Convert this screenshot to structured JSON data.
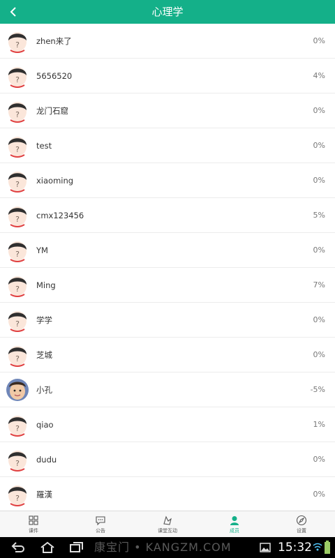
{
  "header": {
    "title": "心理学"
  },
  "members": [
    {
      "name": "zhen来了",
      "percent": "0%",
      "avatar": "default"
    },
    {
      "name": "5656520",
      "percent": "4%",
      "avatar": "default"
    },
    {
      "name": "龙门石窟",
      "percent": "0%",
      "avatar": "default"
    },
    {
      "name": "test",
      "percent": "0%",
      "avatar": "default"
    },
    {
      "name": "xiaoming",
      "percent": "0%",
      "avatar": "default"
    },
    {
      "name": "cmx123456",
      "percent": "5%",
      "avatar": "default"
    },
    {
      "name": "YM",
      "percent": "0%",
      "avatar": "default"
    },
    {
      "name": "Ming",
      "percent": "7%",
      "avatar": "default"
    },
    {
      "name": "学学",
      "percent": "0%",
      "avatar": "default"
    },
    {
      "name": "芝城",
      "percent": "0%",
      "avatar": "default"
    },
    {
      "name": "小孔",
      "percent": "-5%",
      "avatar": "photo"
    },
    {
      "name": "qiao",
      "percent": "1%",
      "avatar": "default"
    },
    {
      "name": "dudu",
      "percent": "0%",
      "avatar": "default"
    },
    {
      "name": "羅漢",
      "percent": "0%",
      "avatar": "default"
    }
  ],
  "tabs": [
    {
      "label": "课件",
      "icon": "grid-icon",
      "active": false
    },
    {
      "label": "公告",
      "icon": "chat-icon",
      "active": false
    },
    {
      "label": "课堂互动",
      "icon": "interaction-icon",
      "active": false
    },
    {
      "label": "成员",
      "icon": "member-icon",
      "active": true
    },
    {
      "label": "设置",
      "icon": "compass-icon",
      "active": false
    }
  ],
  "system_bar": {
    "watermark": "康宝门 • KANGZM.COM",
    "time": "15:32"
  },
  "colors": {
    "accent": "#14b089",
    "header_text": "#ffffff"
  }
}
